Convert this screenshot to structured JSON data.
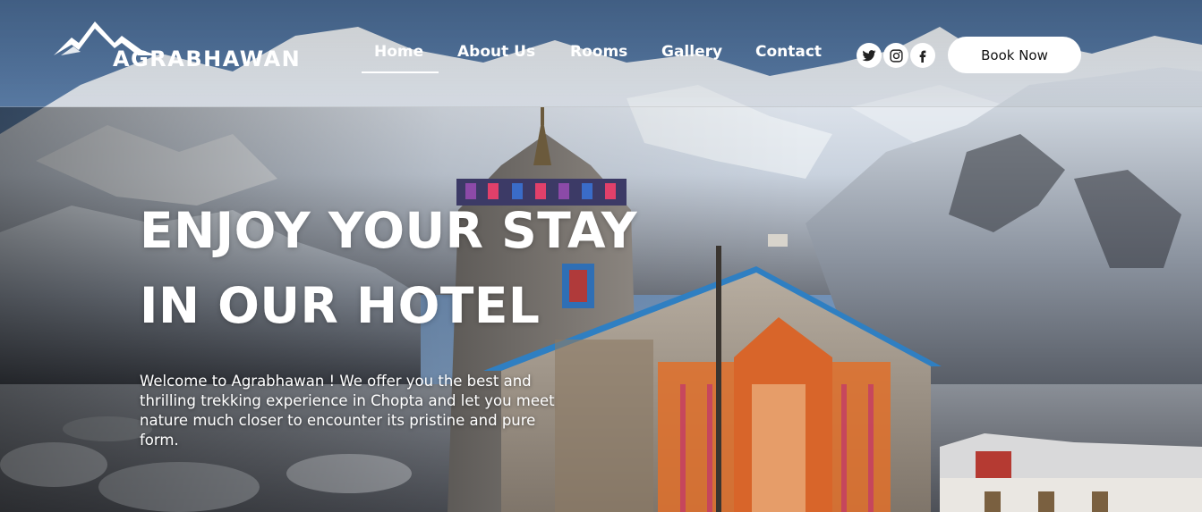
{
  "brand": {
    "name": "AGRABHAWAN",
    "logo_icon": "mountain-icon"
  },
  "nav": {
    "items": [
      {
        "label": "Home",
        "active": true
      },
      {
        "label": "About Us",
        "active": false
      },
      {
        "label": "Rooms",
        "active": false
      },
      {
        "label": "Gallery",
        "active": false
      },
      {
        "label": "Contact",
        "active": false
      }
    ]
  },
  "social": [
    {
      "name": "twitter-icon"
    },
    {
      "name": "instagram-icon"
    },
    {
      "name": "facebook-icon"
    }
  ],
  "cta": {
    "book_label": "Book Now"
  },
  "hero": {
    "headline_line1": "ENJOY YOUR STAY",
    "headline_line2": "IN OUR HOTEL",
    "intro": "Welcome to Agrabhawan ! We offer you the best and thrilling trekking experience in Chopta and let you meet nature much closer to encounter its pristine and pure form."
  },
  "colors": {
    "text": "#ffffff",
    "button_bg": "#ffffff",
    "button_text": "#111111",
    "sky": "#5b7fa8",
    "snow": "#e6ecf3",
    "rock": "#6b6a70",
    "temple_roof": "#2f7fc2",
    "garland": "#e0702a"
  }
}
